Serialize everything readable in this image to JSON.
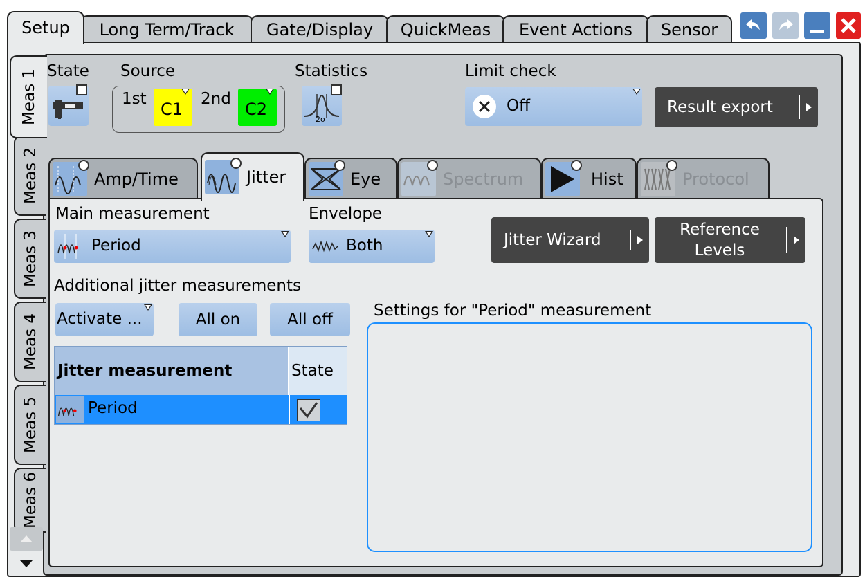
{
  "top_tabs": [
    "Setup",
    "Long Term/Track",
    "Gate/Display",
    "QuickMeas",
    "Event Actions",
    "Sensor"
  ],
  "meas_tabs": [
    "Meas 1",
    "Meas 2",
    "Meas 3",
    "Meas 4",
    "Meas 5",
    "Meas 6"
  ],
  "window_buttons": [
    "undo-icon",
    "redo-icon",
    "minimize-icon",
    "close-icon"
  ],
  "state": {
    "label": "State"
  },
  "source": {
    "label": "Source",
    "first_label": "1st",
    "first_value": "C1",
    "second_label": "2nd",
    "second_value": "C2",
    "first_color": "#ffff00",
    "second_color": "#00ee00"
  },
  "statistics": {
    "label": "Statistics",
    "icon_caption": "2σ"
  },
  "limit_check": {
    "label": "Limit check",
    "value": "Off"
  },
  "result_export": {
    "label": "Result export"
  },
  "sub_tabs": [
    "Amp/Time",
    "Jitter",
    "Eye",
    "Spectrum",
    "Hist",
    "Protocol"
  ],
  "main_measurement": {
    "label": "Main measurement",
    "value": "Period"
  },
  "envelope": {
    "label": "Envelope",
    "value": "Both"
  },
  "jitter_wizard": {
    "label": "Jitter Wizard"
  },
  "reference_levels": {
    "line1": "Reference",
    "line2": "Levels"
  },
  "additional": {
    "label": "Additional jitter measurements",
    "activate": "Activate ...",
    "all_on": "All on",
    "all_off": "All off"
  },
  "table": {
    "col1": "Jitter measurement",
    "col2": "State",
    "rows": [
      {
        "name": "Period",
        "checked": true
      }
    ]
  },
  "settings_title": "Settings for \"Period\" measurement",
  "colors": {
    "accent": "#1e90ff",
    "selected_row": "#1e8fff",
    "dark_button": "#444444"
  }
}
